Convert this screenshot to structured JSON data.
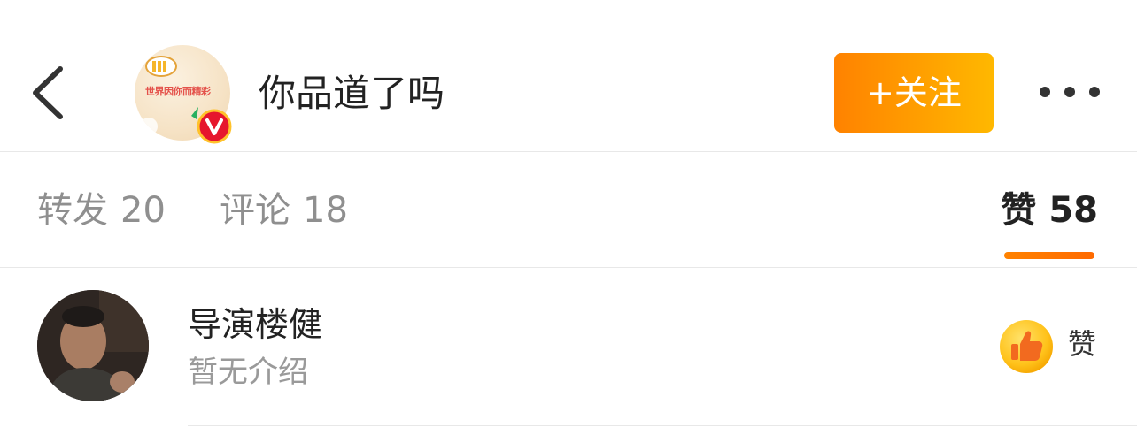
{
  "header": {
    "account_name": "你品道了吗",
    "avatar_slogan": "世界因你而精彩",
    "follow_label": "+关注",
    "icons": {
      "back": "chevron-left-icon",
      "verified": "verified-v-badge-icon",
      "more": "more-dots-icon"
    }
  },
  "tabs": [
    {
      "label": "转发",
      "count": "20",
      "active": false
    },
    {
      "label": "评论",
      "count": "18",
      "active": false
    },
    {
      "label": "赞",
      "count": "58",
      "active": true
    }
  ],
  "list": {
    "items": [
      {
        "name": "导演楼健",
        "description": "暂无介绍",
        "like_label": "赞",
        "like_icon": "thumbs-up-icon"
      }
    ]
  },
  "colors": {
    "accent_orange": "#ff8200",
    "follow_gradient_end": "#ffb800",
    "text_primary": "#222222",
    "text_secondary": "#8f8f8f",
    "verified_red": "#e6162d",
    "verified_ring": "#ffc22b"
  }
}
